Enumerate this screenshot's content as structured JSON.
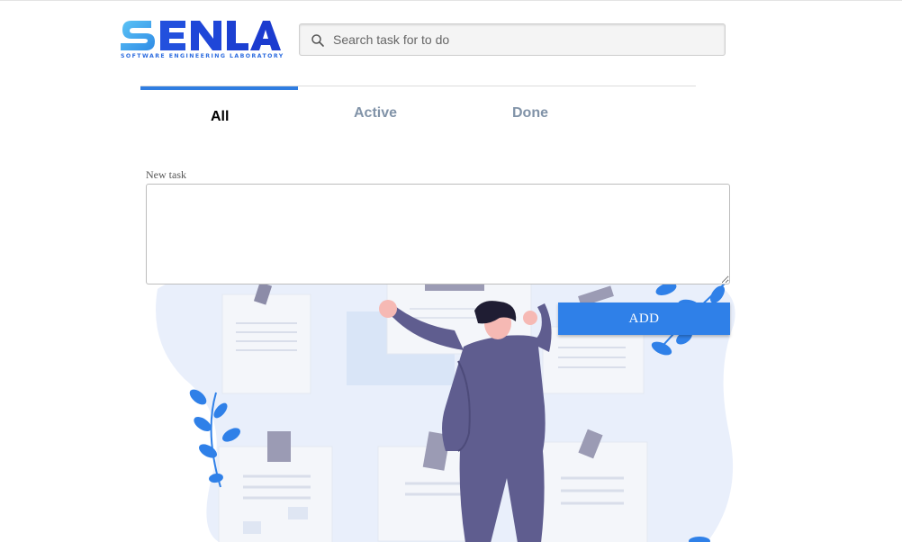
{
  "logo": {
    "wordmark": "SENLA",
    "tagline": "SOFTWARE ENGINEERING LABORATORY",
    "colors": {
      "light": "#4fb3f0",
      "dark": "#1b3fd6"
    }
  },
  "search": {
    "placeholder": "Search task for to do",
    "value": "",
    "icon": "search-icon"
  },
  "tabs": [
    {
      "label": "All",
      "selected": true
    },
    {
      "label": "Active",
      "selected": false
    },
    {
      "label": "Done",
      "selected": false
    }
  ],
  "new_task": {
    "label": "New task",
    "value": ""
  },
  "add_button": {
    "label": "ADD"
  },
  "colors": {
    "accent": "#2f80e8",
    "tab_inactive": "#8193a8",
    "illustration_bg": "#e9effb",
    "figure": "#5f5d8f"
  }
}
